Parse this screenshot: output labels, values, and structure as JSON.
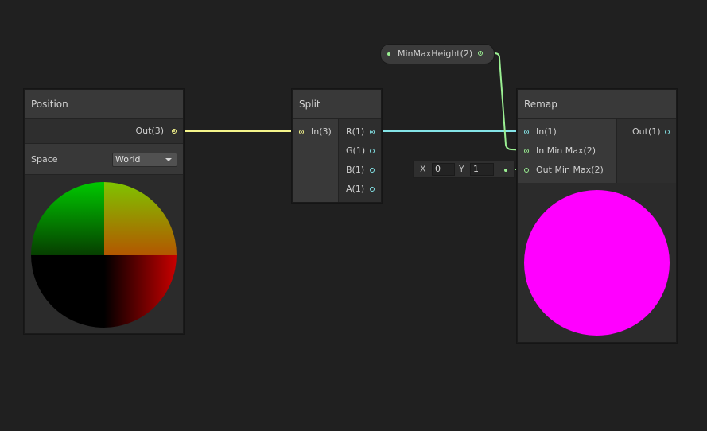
{
  "colors": {
    "background": "#202020",
    "vector3_wire": "#f5f58b",
    "float_wire": "#84e4e7",
    "vector2_wire": "#9aef92",
    "magenta_preview": "#ff00ff"
  },
  "position_node": {
    "title": "Position",
    "output_port": "Out(3)",
    "space_label": "Space",
    "space_value": "World",
    "dropdown_icon": "caret-down"
  },
  "split_node": {
    "title": "Split",
    "input_port": "In(3)",
    "outputs": [
      "R(1)",
      "G(1)",
      "B(1)",
      "A(1)"
    ]
  },
  "property_node": {
    "label": "MinMaxHeight(2)"
  },
  "inline_vector": {
    "x_label": "X",
    "x_value": "0",
    "y_label": "Y",
    "y_value": "1"
  },
  "remap_node": {
    "title": "Remap",
    "inputs": [
      "In(1)",
      "In Min Max(2)",
      "Out Min Max(2)"
    ],
    "output_port": "Out(1)"
  }
}
